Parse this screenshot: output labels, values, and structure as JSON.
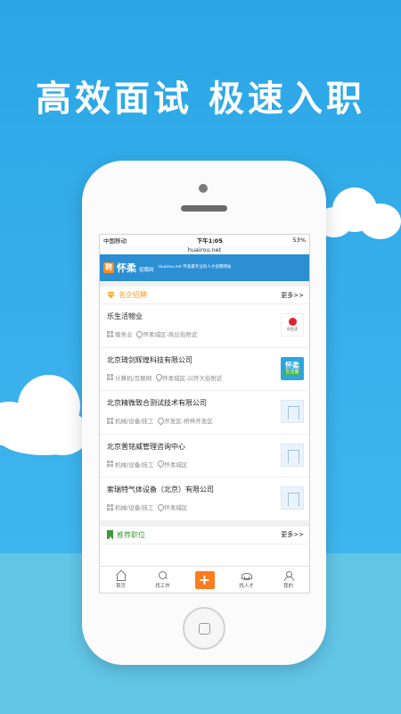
{
  "headline": "高效面试 极速入职",
  "status_bar": {
    "carrier": "中国移动",
    "time": "下午1:05",
    "battery": "53%"
  },
  "url": "huairou.net",
  "brand": {
    "logo_char": "聘",
    "name": "怀柔",
    "sub": "招聘网",
    "tagline": "Huairou.net 怀柔最专业的人才招聘网站"
  },
  "featured_section": {
    "title": "名企招聘",
    "more": "更多>>",
    "icon": "diamond-icon"
  },
  "companies": [
    {
      "name": "乐生活物业",
      "industry": "服务业",
      "location": "怀柔城区-商业街附近",
      "logo": "red-dot-logo",
      "logo_text": "乐生活"
    },
    {
      "name": "北京琦剑辉煌科技有限公司",
      "industry": "计算机/互联网",
      "location": "怀柔城区-兴怀大街附近",
      "logo": "huairou-life-logo",
      "logo_text_1": "怀柔",
      "logo_text_2": "生活圈"
    },
    {
      "name": "北京精微致合测试技术有限公司",
      "industry": "机械/设备/技工",
      "location": "开发区-桥梓开发区",
      "logo": "placeholder-logo"
    },
    {
      "name": "北京普铭威管理咨询中心",
      "industry": "机械/设备/技工",
      "location": "怀柔城区",
      "logo": "placeholder-logo"
    },
    {
      "name": "索瑞特气体设备（北京）有限公司",
      "industry": "机械/设备/技工",
      "location": "怀柔城区",
      "logo": "placeholder-logo"
    }
  ],
  "recommended_section": {
    "title": "推荐职位",
    "more": "更多>>",
    "icon": "bookmark-icon"
  },
  "tabbar": [
    {
      "label": "首页",
      "icon": "home-icon"
    },
    {
      "label": "找工作",
      "icon": "search-icon"
    },
    {
      "label": "+",
      "icon": "plus-icon"
    },
    {
      "label": "找人才",
      "icon": "cap-icon"
    },
    {
      "label": "我的",
      "icon": "person-icon"
    }
  ],
  "colors": {
    "sky": "#2aa6e6",
    "brand_blue": "#2c8fd4",
    "accent_orange": "#ff7b1c",
    "section_green": "#3f9a3a"
  }
}
